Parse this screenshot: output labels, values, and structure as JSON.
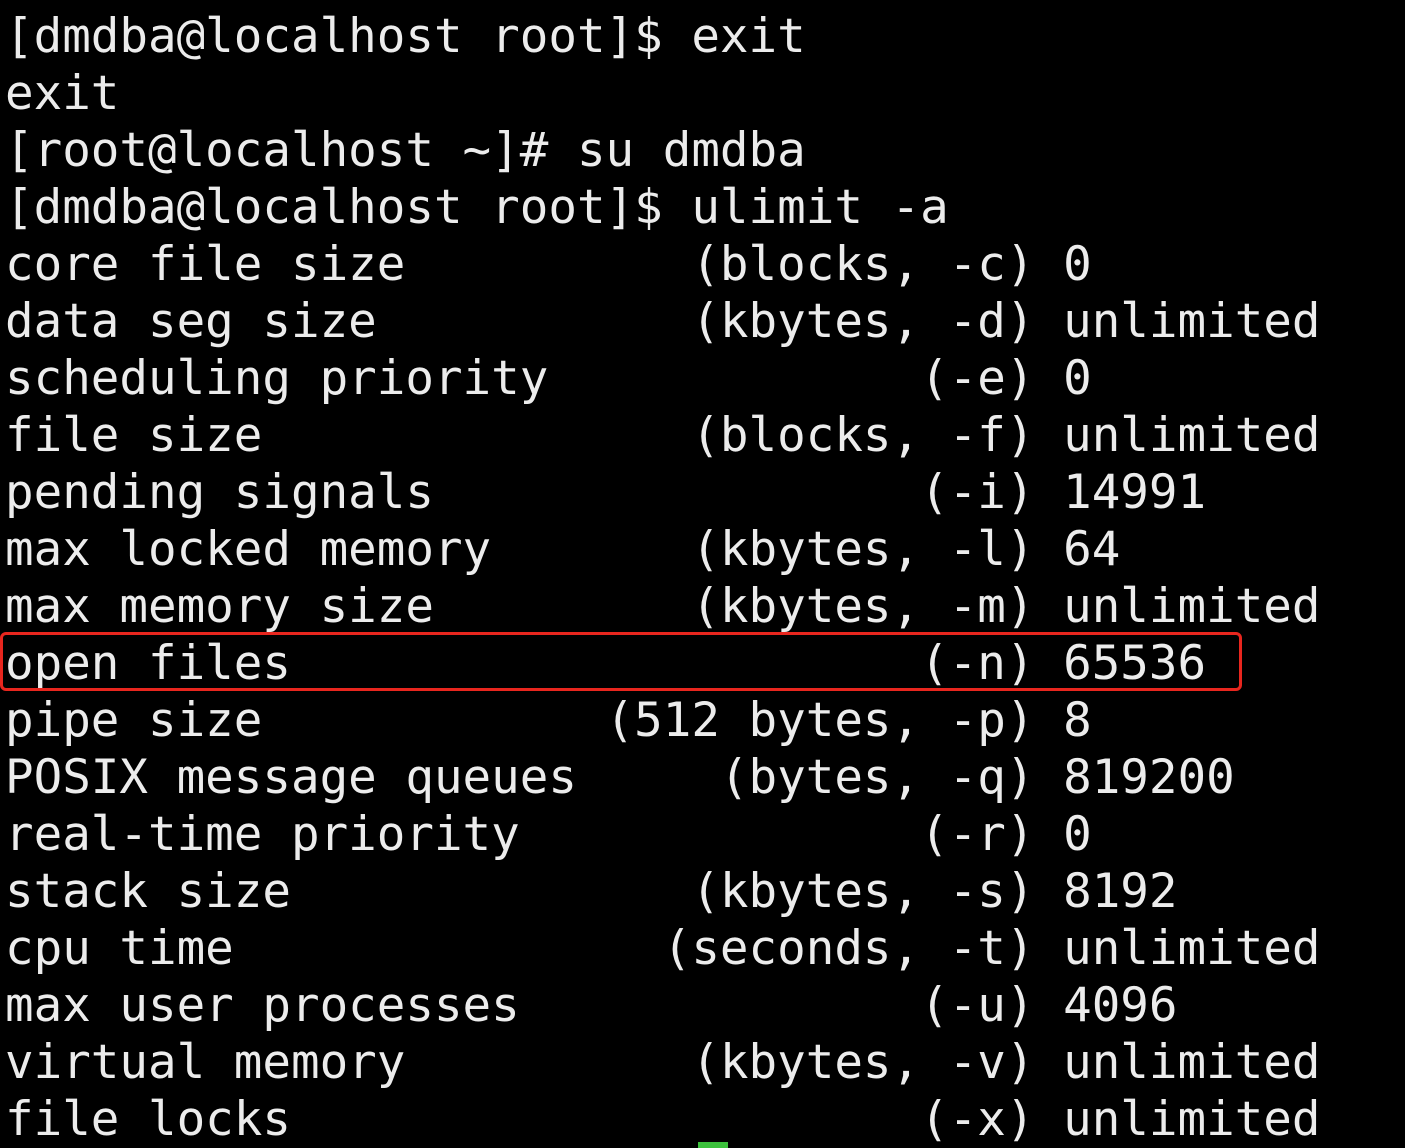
{
  "terminal": {
    "lines": [
      "[dmdba@localhost root]$ exit",
      "exit",
      "[root@localhost ~]# su dmdba",
      "[dmdba@localhost root]$ ulimit -a",
      "core file size          (blocks, -c) 0",
      "data seg size           (kbytes, -d) unlimited",
      "scheduling priority             (-e) 0",
      "file size               (blocks, -f) unlimited",
      "pending signals                 (-i) 14991",
      "max locked memory       (kbytes, -l) 64",
      "max memory size         (kbytes, -m) unlimited",
      "open files                      (-n) 65536",
      "pipe size            (512 bytes, -p) 8",
      "POSIX message queues     (bytes, -q) 819200",
      "real-time priority              (-r) 0",
      "stack size              (kbytes, -s) 8192",
      "cpu time               (seconds, -t) unlimited",
      "max user processes              (-u) 4096",
      "virtual memory          (kbytes, -v) unlimited",
      "file locks                      (-x) unlimited"
    ],
    "highlighted_line_index": 11,
    "colors": {
      "background": "#000000",
      "foreground": "#ececec",
      "highlight_border": "#e8261e",
      "cursor": "#3cc13c"
    }
  }
}
